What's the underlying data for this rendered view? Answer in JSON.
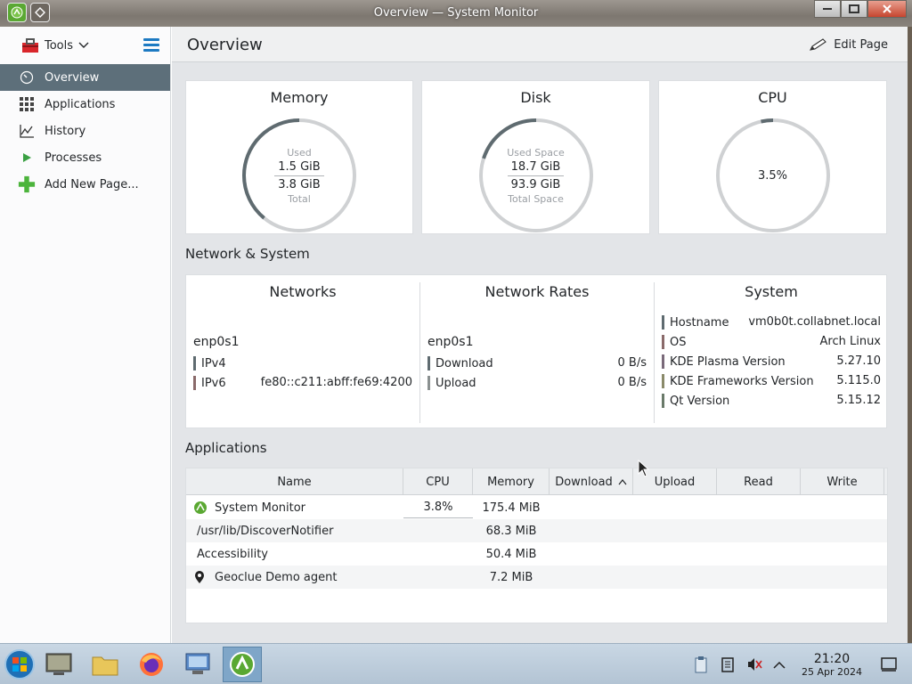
{
  "window": {
    "title": "Overview — System Monitor"
  },
  "sidebar": {
    "tools_label": "Tools",
    "items": [
      {
        "label": "Overview",
        "icon": "speedometer-icon",
        "active": true
      },
      {
        "label": "Applications",
        "icon": "apps-grid-icon"
      },
      {
        "label": "History",
        "icon": "line-chart-icon"
      },
      {
        "label": "Processes",
        "icon": "play-icon"
      },
      {
        "label": "Add New Page...",
        "icon": "plus-icon"
      }
    ]
  },
  "header": {
    "page_title": "Overview",
    "edit_label": "Edit Page"
  },
  "cards": {
    "memory": {
      "title": "Memory",
      "used_label": "Used",
      "used": "1.5 GiB",
      "total": "3.8 GiB",
      "total_label": "Total",
      "fraction": 0.39
    },
    "disk": {
      "title": "Disk",
      "used_label": "Used Space",
      "used": "18.7 GiB",
      "total": "93.9 GiB",
      "total_label": "Total Space",
      "fraction": 0.2
    },
    "cpu": {
      "title": "CPU",
      "value": "3.5%",
      "fraction": 0.035
    }
  },
  "network_section": {
    "title": "Network & System",
    "networks": {
      "title": "Networks",
      "iface": "enp0s1",
      "rows": [
        {
          "k": "IPv4",
          "v": ""
        },
        {
          "k": "IPv6",
          "v": "fe80::c211:abff:fe69:4200"
        }
      ]
    },
    "rates": {
      "title": "Network Rates",
      "iface": "enp0s1",
      "rows": [
        {
          "k": "Download",
          "v": "0 B/s"
        },
        {
          "k": "Upload",
          "v": "0 B/s"
        }
      ]
    },
    "system": {
      "title": "System",
      "rows": [
        {
          "k": "Hostname",
          "v": "vm0b0t.collabnet.local"
        },
        {
          "k": "OS",
          "v": "Arch Linux"
        },
        {
          "k": "KDE Plasma Version",
          "v": "5.27.10"
        },
        {
          "k": "KDE Frameworks Version",
          "v": "5.115.0"
        },
        {
          "k": "Qt Version",
          "v": "5.15.12"
        }
      ]
    }
  },
  "applications": {
    "title": "Applications",
    "columns": [
      "Name",
      "CPU",
      "Memory",
      "Download",
      "Upload",
      "Read",
      "Write"
    ],
    "rows": [
      {
        "name": "System Monitor",
        "cpu": "3.8%",
        "memory": "175.4 MiB",
        "icon": "system-monitor-icon"
      },
      {
        "name": "/usr/lib/DiscoverNotifier",
        "cpu": "",
        "memory": "68.3 MiB",
        "icon": ""
      },
      {
        "name": "Accessibility",
        "cpu": "",
        "memory": "50.4 MiB",
        "icon": ""
      },
      {
        "name": "Geoclue Demo agent",
        "cpu": "",
        "memory": "7.2 MiB",
        "icon": "location-pin-icon"
      }
    ]
  },
  "taskbar": {
    "time": "21:20",
    "date": "25 Apr 2024"
  },
  "colors": {
    "accent": "#1d7ac2",
    "selection": "#5d6f7a",
    "gauge_track": "#cfd1d3",
    "gauge_fill": "#5f6b70"
  }
}
